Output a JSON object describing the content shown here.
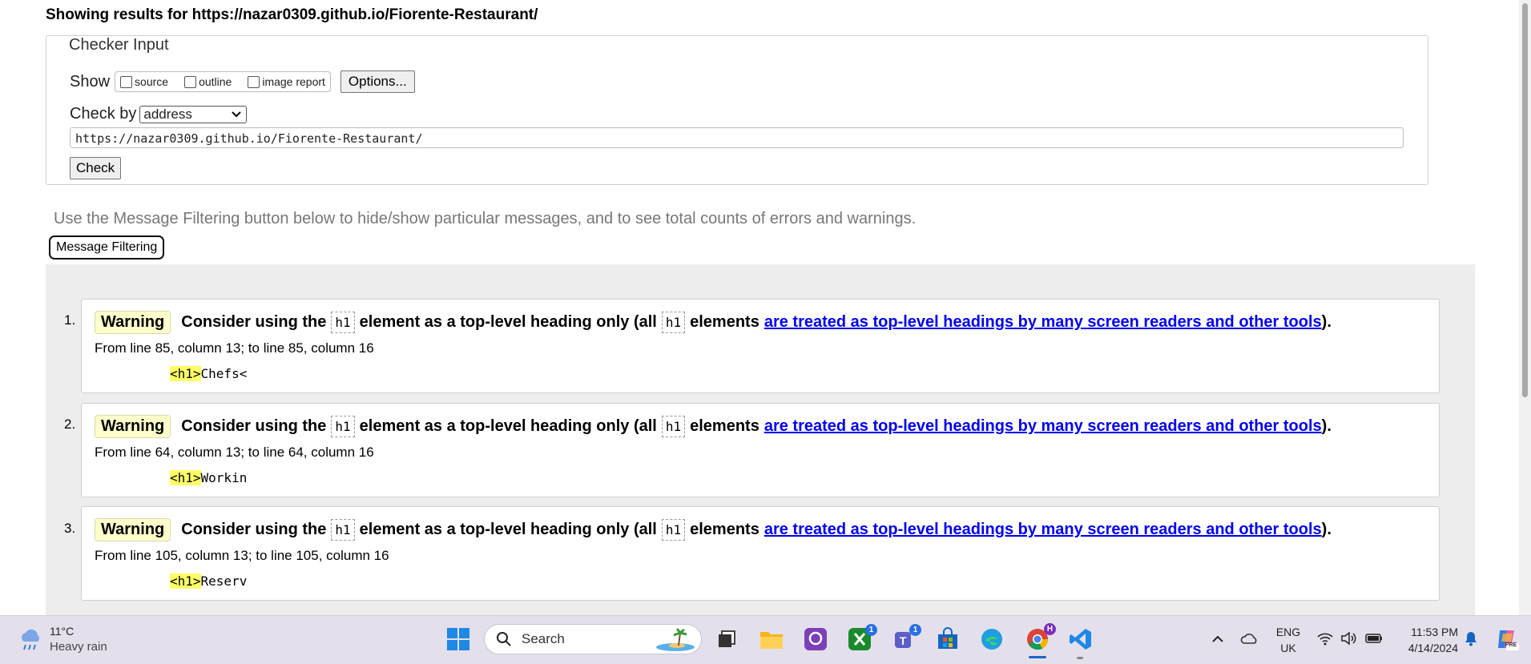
{
  "page": {
    "results_title": "Showing results for https://nazar0309.github.io/Fiorente-Restaurant/"
  },
  "checker": {
    "legend": "Checker Input",
    "show_label": "Show",
    "options": [
      "source",
      "outline",
      "image report"
    ],
    "options_button": "Options...",
    "checkby_label": "Check by",
    "checkby_value": "address",
    "url_value": "https://nazar0309.github.io/Fiorente-Restaurant/",
    "check_button": "Check"
  },
  "filter": {
    "note": "Use the Message Filtering button below to hide/show particular messages, and to see total counts of errors and warnings.",
    "button": "Message Filtering"
  },
  "messages": [
    {
      "num": "1.",
      "type": "Warning",
      "text_a": "Consider using the",
      "code": "h1",
      "text_b": "element as a top-level heading only (all",
      "text_c": "elements",
      "link": "are treated as top-level headings by many screen readers and other tools",
      "text_d": ").",
      "location": "From line 85, column 13; to line 85, column 16",
      "extract_tag": "<h1>",
      "extract_rest": "Chefs<"
    },
    {
      "num": "2.",
      "type": "Warning",
      "text_a": "Consider using the",
      "code": "h1",
      "text_b": "element as a top-level heading only (all",
      "text_c": "elements",
      "link": "are treated as top-level headings by many screen readers and other tools",
      "text_d": ").",
      "location": "From line 64, column 13; to line 64, column 16",
      "extract_tag": "<h1>",
      "extract_rest": "Workin"
    },
    {
      "num": "3.",
      "type": "Warning",
      "text_a": "Consider using the",
      "code": "h1",
      "text_b": "element as a top-level heading only (all",
      "text_c": "elements",
      "link": "are treated as top-level headings by many screen readers and other tools",
      "text_d": ").",
      "location": "From line 105, column 13; to line 105, column 16",
      "extract_tag": "<h1>",
      "extract_rest": "Reserv"
    }
  ],
  "taskbar": {
    "weather_temp": "11°C",
    "weather_cond": "Heavy rain",
    "search_placeholder": "Search",
    "xbox_badge": "1",
    "teams_badge": "1",
    "chrome_profile": "H",
    "lang_line1": "ENG",
    "lang_line2": "UK",
    "time": "11:53 PM",
    "date": "4/14/2024",
    "copilot_label": "PRE",
    "icons": [
      "weather-rain-icon",
      "windows-start-icon",
      "search-icon",
      "task-view-icon",
      "file-explorer-icon",
      "photos-app-icon",
      "xbox-icon",
      "teams-icon",
      "microsoft-store-icon",
      "edge-icon",
      "chrome-icon",
      "vscode-icon",
      "chevron-up-icon",
      "onedrive-icon",
      "wifi-icon",
      "volume-icon",
      "battery-icon",
      "notification-bell-icon",
      "copilot-icon"
    ]
  },
  "colors": {
    "warning_bg": "#ffffcc",
    "link": "#0000ee",
    "highlight": "#ffff66",
    "results_bg": "#ededed",
    "taskbar_bg": "#e3e0ec"
  }
}
